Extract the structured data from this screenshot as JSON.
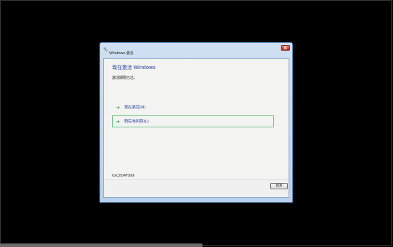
{
  "window": {
    "title": "Windows 激活",
    "icon": "activation-icon",
    "close_label": "x"
  },
  "main": {
    "heading": "现在激活 Windows",
    "message": "激活期限已过。",
    "options": [
      {
        "label": "现在激活(N)",
        "icon": "green-arrow-icon"
      },
      {
        "label": "稍后询问我(L)",
        "icon": "green-arrow-icon"
      }
    ],
    "error_code": "0xC004F009"
  },
  "footer": {
    "cancel_label": "取消"
  },
  "colors": {
    "heading": "#1e3c96",
    "arrow": "#2c9a48",
    "focus_border": "#6fc38a"
  }
}
